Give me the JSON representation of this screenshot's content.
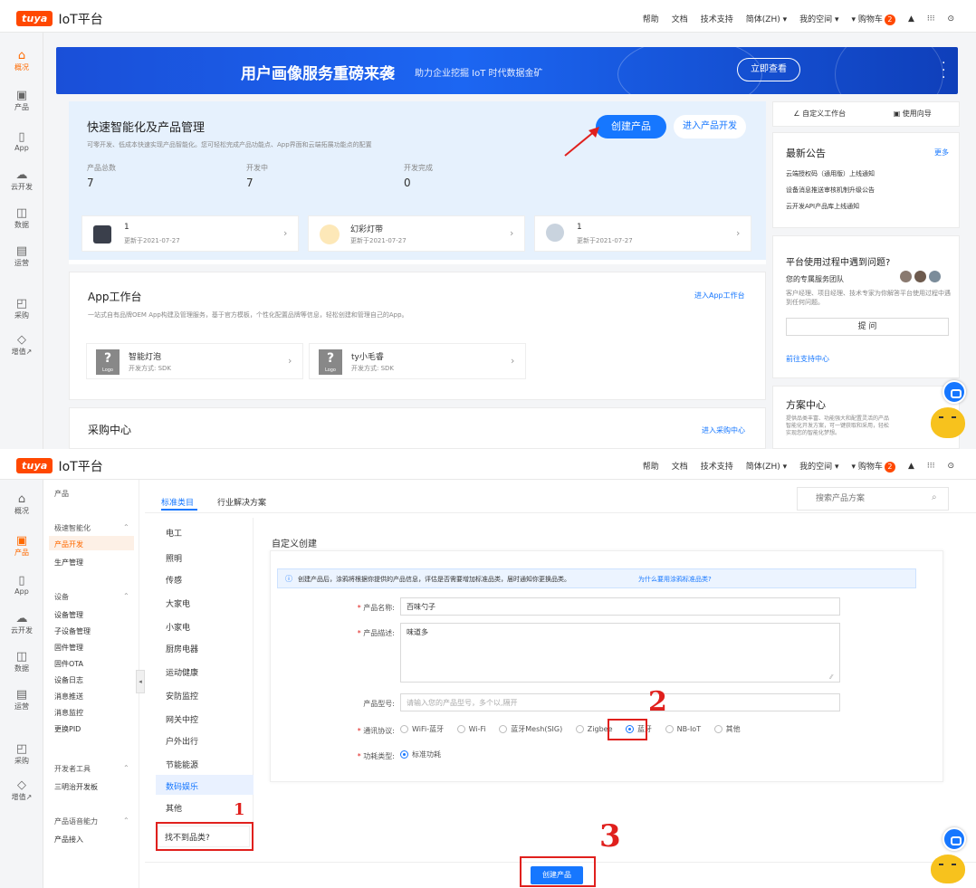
{
  "topbar": {
    "logo_badge": "tuya",
    "logo_text": "IoT平台",
    "nav": [
      "帮助",
      "文档",
      "技术支持",
      "简体(ZH) ▾",
      "我的空间 ▾",
      "购物车"
    ],
    "cart_count": "2"
  },
  "sidebar_top": [
    {
      "label": "概况",
      "icon": "home-icon",
      "glyph": "⌂"
    },
    {
      "label": "产品",
      "icon": "product-icon",
      "glyph": "▣"
    },
    {
      "label": "App",
      "icon": "phone-icon",
      "glyph": "▯"
    },
    {
      "label": "云开发",
      "icon": "cloud-icon",
      "glyph": "☁"
    },
    {
      "label": "数据",
      "icon": "chart-icon",
      "glyph": "◫"
    },
    {
      "label": "运营",
      "icon": "clipboard-icon",
      "glyph": "▤"
    },
    {
      "label": "采购",
      "icon": "bag-icon",
      "glyph": "◰"
    },
    {
      "label": "增值↗",
      "icon": "diamond-icon",
      "glyph": "◇"
    }
  ],
  "sidebar_bottom": [
    {
      "label": "概况",
      "icon": "home-icon",
      "glyph": "⌂"
    },
    {
      "label": "产品",
      "icon": "product-icon",
      "glyph": "▣"
    },
    {
      "label": "App",
      "icon": "phone-icon",
      "glyph": "▯"
    },
    {
      "label": "云开发",
      "icon": "cloud-icon",
      "glyph": "☁"
    },
    {
      "label": "数据",
      "icon": "chart-icon",
      "glyph": "◫"
    },
    {
      "label": "运营",
      "icon": "clipboard-icon",
      "glyph": "▤"
    },
    {
      "label": "采购",
      "icon": "bag-icon",
      "glyph": "◰"
    },
    {
      "label": "增值↗",
      "icon": "diamond-icon",
      "glyph": "◇"
    }
  ],
  "banner": {
    "title": "用户画像服务重磅来袭",
    "subtitle": "助力企业挖掘 IoT 时代数据金矿",
    "button": "立即查看"
  },
  "quick": {
    "title": "快速智能化及产品管理",
    "desc": "可零开发、低成本快速实现产品智能化。您可轻松完成产品功能点、App界面和云端拓展功能点的配置",
    "create_btn": "创建产品",
    "dev_btn": "进入产品开发",
    "stats": [
      {
        "label": "产品总数",
        "value": "7"
      },
      {
        "label": "开发中",
        "value": "7"
      },
      {
        "label": "开发完成",
        "value": "0"
      }
    ],
    "products": [
      {
        "name": "1",
        "updated": "更新于2021-07-27"
      },
      {
        "name": "幻彩灯带",
        "updated": "更新于2021-07-27"
      },
      {
        "name": "1",
        "updated": "更新于2021-07-27"
      }
    ]
  },
  "appwork": {
    "title": "App工作台",
    "link": "进入App工作台",
    "desc": "一站式自有品牌OEM App构建及管理服务，基于官方模板，个性化配置品牌等信息，轻松创建和管理自己的App。",
    "apps": [
      {
        "name": "智能灯泡",
        "mode": "开发方式: SDK"
      },
      {
        "name": "ty小毛睿",
        "mode": "开发方式: SDK"
      }
    ],
    "logo_label": "Logo"
  },
  "purchase": {
    "title": "采购中心",
    "link": "进入采购中心"
  },
  "right": {
    "workbench": "自定义工作台",
    "guide": "使用向导",
    "notice_title": "最新公告",
    "notice_more": "更多",
    "notices": [
      "云端授权码（通用版）上线通知",
      "设备消息推送审核机制升级公告",
      "云开发API产品库上线通知"
    ],
    "help_title": "平台使用过程中遇到问题?",
    "team": "您的专属服务团队",
    "team_desc": "客户经理、项目经理、技术专家为你解答平台使用过程中遇到任何问题。",
    "ask_btn": "提 问",
    "support_link": "前往支持中心",
    "solution_title": "方案中心",
    "solution_desc": "提供品类丰富、功能强大和配置灵活的产品智能化开发方案，可一键获取和采用，轻松实现您的智能化梦想。"
  },
  "bottom": {
    "product_header": "产品",
    "menu": {
      "group1": "极速智能化",
      "group1_items": [
        "产品开发",
        "生产管理"
      ],
      "group2": "设备",
      "group2_items": [
        "设备管理",
        "子设备管理",
        "固件管理",
        "固件OTA",
        "设备日志",
        "消息推送",
        "消息监控",
        "更换PID"
      ],
      "group3": "开发者工具",
      "group3_items": [
        "三明治开发板"
      ],
      "group4": "产品语音能力",
      "group4_items": [
        "产品接入"
      ]
    },
    "tabs": [
      "标准类目",
      "行业解决方案"
    ],
    "search_placeholder": "搜索产品方案",
    "categories": [
      "电工",
      "照明",
      "传感",
      "大家电",
      "小家电",
      "厨房电器",
      "运动健康",
      "安防监控",
      "网关中控",
      "户外出行",
      "节能能源",
      "数码娱乐",
      "其他"
    ],
    "not_found": "找不到品类?",
    "form_title": "自定义创建",
    "info_text": "创建产品后，涂鸦将根据你提供的产品信息，评估是否需要增加标准品类，届时通知你更换品类。",
    "info_link": "为什么要用涂鸦标准品类?",
    "labels": {
      "name": "产品名称:",
      "desc": "产品描述:",
      "model": "产品型号:",
      "protocol": "通讯协议:",
      "power": "功耗类型:"
    },
    "values": {
      "name": "百味勺子",
      "desc": "味道多",
      "model_placeholder": "请输入您的产品型号，多个以,隔开"
    },
    "protocols": [
      "WiFi-蓝牙",
      "Wi-Fi",
      "蓝牙Mesh(SIG)",
      "Zigbee",
      "蓝牙",
      "NB-IoT",
      "其他"
    ],
    "protocol_selected": "蓝牙",
    "power_option": "标准功耗",
    "create_btn": "创建产品"
  },
  "annotations": [
    "1",
    "2",
    "3"
  ]
}
